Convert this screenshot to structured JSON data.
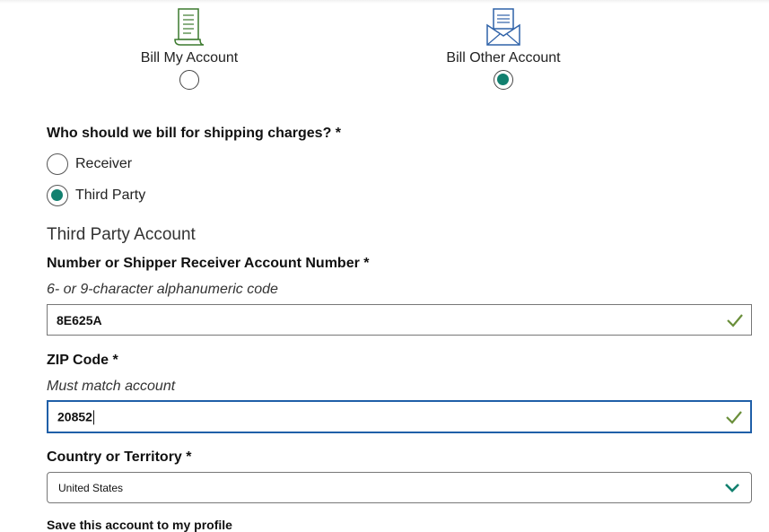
{
  "billing_options": [
    {
      "label": "Bill My Account",
      "selected": false,
      "icon": "receipt-icon"
    },
    {
      "label": "Bill Other Account",
      "selected": true,
      "icon": "envelope-letter-icon"
    }
  ],
  "who_to_bill": {
    "question": "Who should we bill for shipping charges? *",
    "options": [
      {
        "label": "Receiver",
        "selected": false
      },
      {
        "label": "Third Party",
        "selected": true
      }
    ]
  },
  "third_party": {
    "section_title": "Third Party Account",
    "account_number": {
      "label": "Number or Shipper Receiver Account Number *",
      "help": "6- or 9-character alphanumeric code",
      "value": "8E625A"
    },
    "zip": {
      "label": "ZIP Code *",
      "help": "Must match account",
      "value": "20852"
    },
    "country": {
      "label": "Country or Territory *",
      "value": "United States"
    }
  },
  "save_account_label": "Save this account to my profile",
  "colors": {
    "accent_green": "#12806f",
    "check_green": "#6a8f3a",
    "icon_green": "#3c7a2e",
    "icon_blue": "#2f62a8",
    "focus_blue": "#1f5fa8"
  }
}
